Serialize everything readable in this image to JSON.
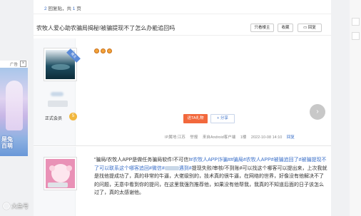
{
  "replies": {
    "count": "2",
    "label_mid": "回复贴，共",
    "pages": "1",
    "label_end": "页"
  },
  "header": {
    "title": "农牧人爱心助农骗局揭秘!被骗提现不了怎么办能追回吗",
    "buttons": {
      "only_lz": "只看楼主",
      "favorite": "收藏",
      "reply": "回复"
    }
  },
  "post1": {
    "badge": "楼主",
    "member_label": "正式会员",
    "level": "5",
    "gift_label": "送TA礼物",
    "share_label": "分享",
    "meta": {
      "ip": "IP属地:江苏",
      "report": "举报",
      "source": "来自Android客户端",
      "floor": "1楼",
      "time": "2022-10-08 14:10",
      "reply": "回复"
    }
  },
  "post2": {
    "seg1": "“骗局/农牧人APP是做任务骗局软件!不可信!",
    "seg2": "#农牧人APP诈骗##骗局#农牧人APP#被骗追回了#被骗提现不了可以联系这个哪客追回#微信#",
    "seg3": "遇到#",
    "seg4": "提现失败/审核/不到账#可以找这个哪客可以提出来，上次我就是找他提成功了，真的非常的牛逼，大佬级别的，技术真的很牛逼，在网络的世界，好像没有他解决不了的问题，无意中看到你的提问，在这里我强烈推荐他，如果没有他帮我，我真的不知道后面的日子该怎么过了，真的太感谢他。"
  },
  "ad": {
    "label": "广告",
    "close": "×",
    "text_line1": "是兔",
    "text_line2": "百萌"
  },
  "watermark": "大鱼号"
}
